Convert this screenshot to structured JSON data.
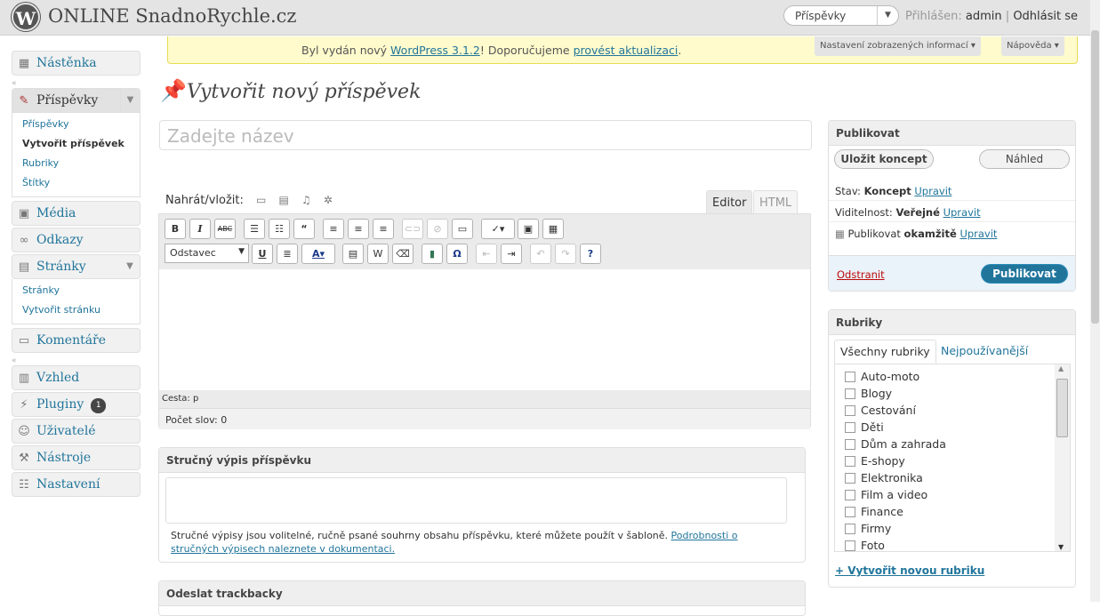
{
  "header": {
    "logo": "W",
    "site_title": "ONLINE SnadnoRychle.cz",
    "favorites_select": "Příspěvky",
    "logged_in_label": "Přihlášen:",
    "user": "admin",
    "separator": "|",
    "logout": "Odhlásit se"
  },
  "notice": {
    "text_before": "Byl vydán nový ",
    "version_link": "WordPress 3.1.2",
    "text_middle": "! Doporučujeme ",
    "update_link": "provést aktualizaci",
    "text_after": ".",
    "screen_options": "Nastavení zobrazených informací ▾",
    "help": "Nápověda ▾"
  },
  "sidebar": {
    "dashboard": "Nástěnka",
    "posts": "Příspěvky",
    "posts_sub": [
      "Příspěvky",
      "Vytvořit příspěvek",
      "Rubriky",
      "Štítky"
    ],
    "media": "Média",
    "links": "Odkazy",
    "pages": "Stránky",
    "pages_sub": [
      "Stránky",
      "Vytvořit stránku"
    ],
    "comments": "Komentáře",
    "appearance": "Vzhled",
    "plugins": "Pluginy",
    "plugins_badge": "1",
    "users": "Uživatelé",
    "tools": "Nástroje",
    "settings": "Nastavení"
  },
  "page": {
    "title": "Vytvořit nový příspěvek",
    "title_placeholder": "Zadejte název"
  },
  "editor": {
    "upload_label": "Nahrát/vložit:",
    "tab_visual": "Editor",
    "tab_html": "HTML",
    "format_select": "Odstavec",
    "path_label": "Cesta: p",
    "word_count": "Počet slov: 0"
  },
  "excerpt": {
    "title": "Stručný výpis příspěvku",
    "help_text": "Stručné výpisy jsou volitelné, ručně psané souhrny obsahu příspěvku, které můžete použít v šabloně. ",
    "help_link": "Podrobnosti o stručných výpisech naleznete v dokumentaci."
  },
  "trackbacks": {
    "title": "Odeslat trackbacky"
  },
  "publish": {
    "title": "Publikovat",
    "save_draft": "Uložit koncept",
    "preview": "Náhled",
    "status_label": "Stav: ",
    "status_value": "Koncept",
    "visibility_label": "Viditelnost: ",
    "visibility_value": "Veřejné",
    "schedule_label": "Publikovat ",
    "schedule_value": "okamžitě",
    "edit_link": "Upravit",
    "delete_link": "Odstranit",
    "publish_button": "Publikovat"
  },
  "categories": {
    "title": "Rubriky",
    "tab_all": "Všechny rubriky",
    "tab_popular": "Nejpoužívanější",
    "items": [
      "Auto-moto",
      "Blogy",
      "Cestování",
      "Děti",
      "Dům a zahrada",
      "E-shopy",
      "Elektronika",
      "Film a video",
      "Finance",
      "Firmy",
      "Foto"
    ],
    "add_new": "+ Vytvořit novou rubriku"
  }
}
